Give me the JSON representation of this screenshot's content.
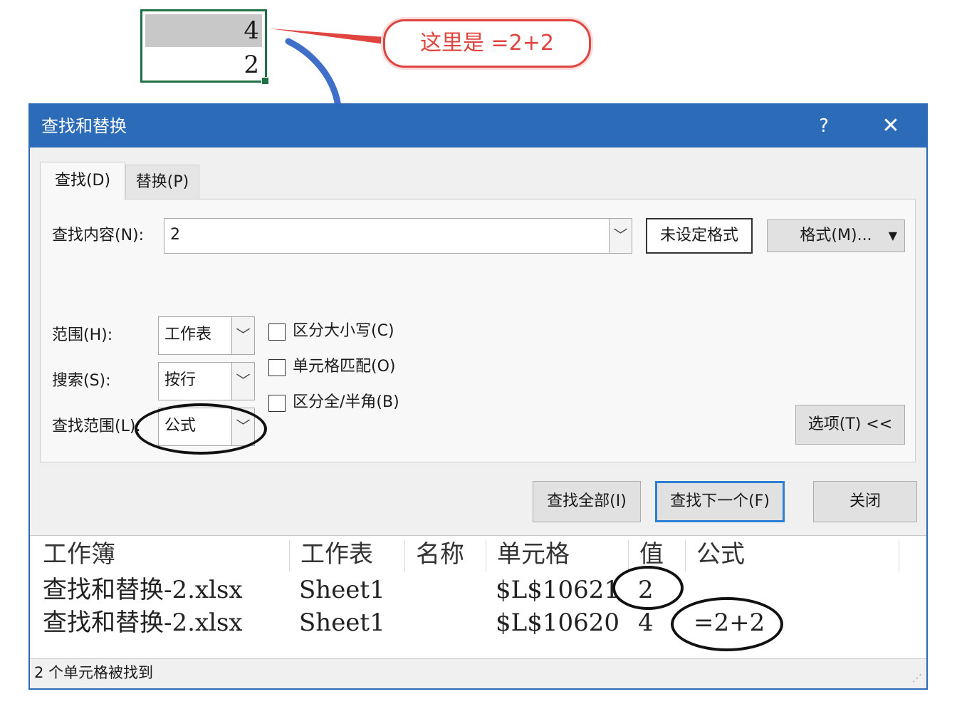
{
  "sheet_cells": [
    "4",
    "2"
  ],
  "callout": "这里是 =2+2",
  "dialog": {
    "title": "查找和替换",
    "help": "?",
    "close": "✕",
    "tabs": [
      "查找(D)",
      "替换(P)"
    ],
    "find_label": "查找内容(N):",
    "find_value": "2",
    "format_preview": "未设定格式",
    "format_button": "格式(M)...",
    "scope_label": "范围(H):",
    "scope_value": "工作表",
    "search_label": "搜索(S):",
    "search_value": "按行",
    "lookin_label": "查找范围(L):",
    "lookin_value": "公式",
    "checkboxes": [
      "区分大小写(C)",
      "单元格匹配(O)",
      "区分全/半角(B)"
    ],
    "options_button": "选项(T) <<",
    "find_all": "查找全部(I)",
    "find_next": "查找下一个(F)",
    "close_button": "关闭",
    "dropdown_glyph": "﹀",
    "format_caret": "▼"
  },
  "results": {
    "columns": [
      "工作簿",
      "工作表",
      "名称",
      "单元格",
      "值",
      "公式"
    ],
    "rows": [
      [
        "查找和替换-2.xlsx",
        "Sheet1",
        "",
        "$L$10621",
        "2",
        ""
      ],
      [
        "查找和替换-2.xlsx",
        "Sheet1",
        "",
        "$L$10620",
        "4",
        "=2+2"
      ]
    ]
  },
  "status": "2 个单元格被找到",
  "colors": {
    "title_bar": "#2b6bb8",
    "callout": "#e0443f",
    "arrow": "#3f6fc9",
    "cell_border": "#1e7145"
  }
}
